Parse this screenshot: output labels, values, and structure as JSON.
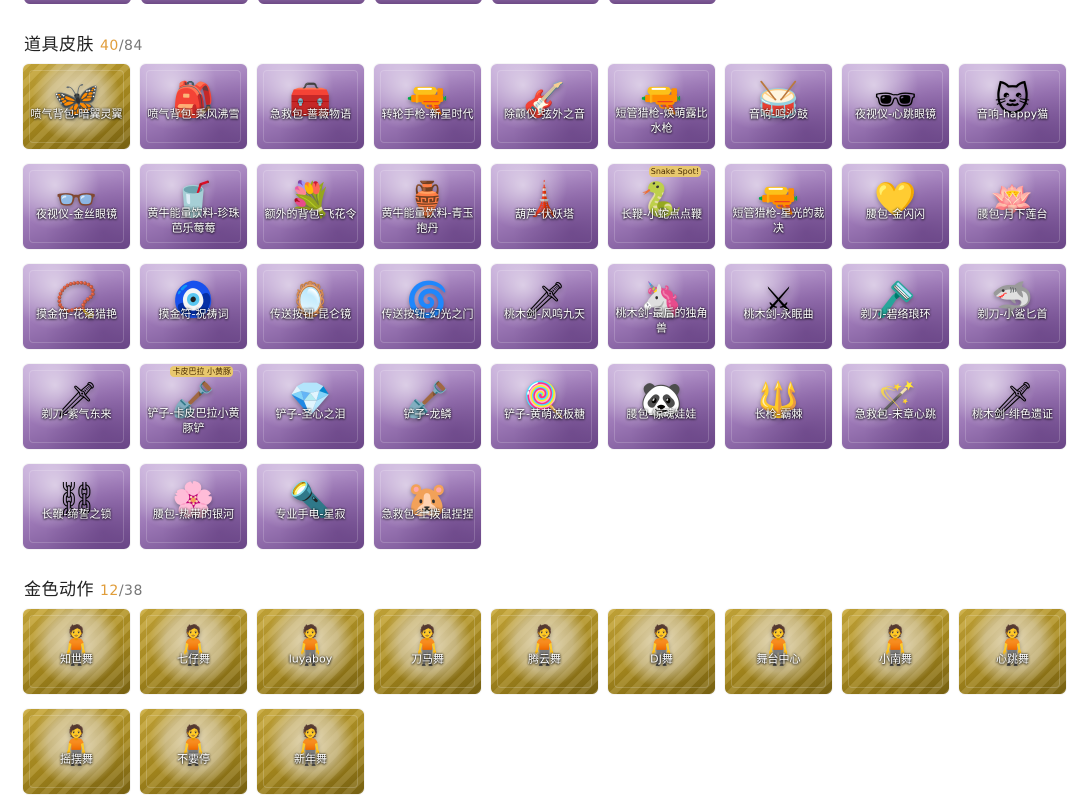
{
  "sections": {
    "items": {
      "title": "道具皮肤",
      "owned": "40",
      "separator": "/",
      "total": "84",
      "tiles": [
        {
          "label": "喷气背包-暗翼灵翼",
          "art": "🦋",
          "style": "gold"
        },
        {
          "label": "喷气背包-乘风沸雪",
          "art": "🎒",
          "style": "purple"
        },
        {
          "label": "急救包-蔷薇物语",
          "art": "🧰",
          "style": "purple"
        },
        {
          "label": "转轮手枪-新星时代",
          "art": "🔫",
          "style": "purple"
        },
        {
          "label": "除颤仪-弦外之音",
          "art": "🎸",
          "style": "purple"
        },
        {
          "label": "短管猎枪-焕萌露比水枪",
          "art": "🔫",
          "style": "purple"
        },
        {
          "label": "音响-鸣沙鼓",
          "art": "🥁",
          "style": "purple"
        },
        {
          "label": "夜视仪-心跳眼镜",
          "art": "🕶",
          "style": "purple"
        },
        {
          "label": "音响-happy猫",
          "art": "🐱",
          "style": "purple"
        },
        {
          "label": "夜视仪-金丝眼镜",
          "art": "👓",
          "style": "purple"
        },
        {
          "label": "黄牛能量饮料-珍珠芭乐莓莓",
          "art": "🥤",
          "style": "purple"
        },
        {
          "label": "额外的背包-飞花令",
          "art": "💐",
          "style": "purple"
        },
        {
          "label": "黄牛能量饮料-青玉抱丹",
          "art": "🏺",
          "style": "purple"
        },
        {
          "label": "葫芦-伏妖塔",
          "art": "🗼",
          "style": "purple"
        },
        {
          "label": "长鞭-小蛇点点鞭",
          "art": "🐍",
          "style": "purple",
          "badge": "Snake Spot!"
        },
        {
          "label": "短管猎枪-星光的裁决",
          "art": "🔫",
          "style": "purple"
        },
        {
          "label": "腰包-金闪闪",
          "art": "💛",
          "style": "purple"
        },
        {
          "label": "腰包-月下莲台",
          "art": "🪷",
          "style": "purple"
        },
        {
          "label": "摸金符-花落猎艳",
          "art": "📿",
          "style": "purple"
        },
        {
          "label": "摸金符-祝祷词",
          "art": "🧿",
          "style": "purple"
        },
        {
          "label": "传送按钮-昆仑镜",
          "art": "🪞",
          "style": "purple"
        },
        {
          "label": "传送按钮-幻光之门",
          "art": "🌀",
          "style": "purple"
        },
        {
          "label": "桃木剑-风鸣九天",
          "art": "🗡",
          "style": "purple"
        },
        {
          "label": "桃木剑-最后的独角兽",
          "art": "🦄",
          "style": "purple"
        },
        {
          "label": "桃木剑-永眠曲",
          "art": "⚔",
          "style": "purple"
        },
        {
          "label": "剃刀-碧络琅环",
          "art": "🪒",
          "style": "purple"
        },
        {
          "label": "剃刀-小鲨匕首",
          "art": "🦈",
          "style": "purple"
        },
        {
          "label": "剃刀-紫气东来",
          "art": "🗡",
          "style": "purple"
        },
        {
          "label": "铲子-卡皮巴拉小黄豚铲",
          "art": "🪏",
          "style": "purple",
          "badge": "卡皮巴拉 小黄豚"
        },
        {
          "label": "铲子-圣心之泪",
          "art": "💎",
          "style": "purple"
        },
        {
          "label": "铲子-龙鳞",
          "art": "🪏",
          "style": "purple"
        },
        {
          "label": "铲子-黄萌波板糖",
          "art": "🍭",
          "style": "purple"
        },
        {
          "label": "腰包-惊魂娃娃",
          "art": "🐼",
          "style": "purple"
        },
        {
          "label": "长枪-霸棘",
          "art": "🔱",
          "style": "purple"
        },
        {
          "label": "急救包-末章心跳",
          "art": "🪄",
          "style": "purple"
        },
        {
          "label": "桃木剑-绯色遗证",
          "art": "🗡",
          "style": "purple"
        },
        {
          "label": "长鞭-缔誓之锁",
          "art": "⛓",
          "style": "purple"
        },
        {
          "label": "腰包-热带的银河",
          "art": "🌸",
          "style": "purple"
        },
        {
          "label": "专业手电-星寂",
          "art": "🔦",
          "style": "purple"
        },
        {
          "label": "急救包-土拨鼠捏捏",
          "art": "🐹",
          "style": "purple"
        }
      ]
    },
    "emotes": {
      "title": "金色动作",
      "owned": "12",
      "separator": "/",
      "total": "38",
      "tiles": [
        {
          "label": "知世舞",
          "art": "🧍",
          "style": "gold"
        },
        {
          "label": "七仔舞",
          "art": "🧍",
          "style": "gold"
        },
        {
          "label": "luyaboy",
          "art": "🧍",
          "style": "gold"
        },
        {
          "label": "刀马舞",
          "art": "🧍",
          "style": "gold"
        },
        {
          "label": "腾云舞",
          "art": "🧍",
          "style": "gold"
        },
        {
          "label": "DJ舞",
          "art": "🧍",
          "style": "gold"
        },
        {
          "label": "舞台中心",
          "art": "🧍",
          "style": "gold"
        },
        {
          "label": "小南舞",
          "art": "🧍",
          "style": "gold"
        },
        {
          "label": "心跳舞",
          "art": "🧍",
          "style": "gold"
        },
        {
          "label": "摇摆舞",
          "art": "🧍",
          "style": "gold"
        },
        {
          "label": "不要停",
          "art": "🧍",
          "style": "gold"
        },
        {
          "label": "新年舞",
          "art": "🧍",
          "style": "gold"
        }
      ]
    }
  }
}
